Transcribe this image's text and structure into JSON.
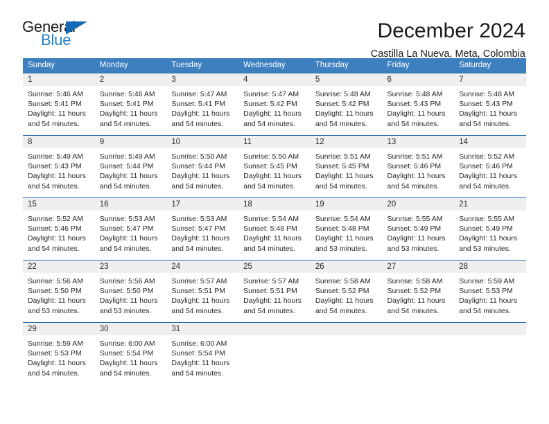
{
  "brand": {
    "name_top": "General",
    "name_bottom": "Blue",
    "triangle_color": "#1469b4",
    "blue_color": "#1f7ec4"
  },
  "header": {
    "title": "December 2024",
    "subtitle": "Castilla La Nueva, Meta, Colombia"
  },
  "theme": {
    "header_bg": "#3d7fbf",
    "row_divider": "#2a6db0",
    "daynum_bg": "#efefef",
    "text": "#272727"
  },
  "weekday_headers": [
    "Sunday",
    "Monday",
    "Tuesday",
    "Wednesday",
    "Thursday",
    "Friday",
    "Saturday"
  ],
  "labels": {
    "sunrise_prefix": "Sunrise:",
    "sunset_prefix": "Sunset:",
    "daylight_prefix": "Daylight:"
  },
  "weeks": [
    [
      {
        "day": "1",
        "sunrise": "Sunrise: 5:46 AM",
        "sunset": "Sunset: 5:41 PM",
        "daylight1": "Daylight: 11 hours",
        "daylight2": "and 54 minutes."
      },
      {
        "day": "2",
        "sunrise": "Sunrise: 5:46 AM",
        "sunset": "Sunset: 5:41 PM",
        "daylight1": "Daylight: 11 hours",
        "daylight2": "and 54 minutes."
      },
      {
        "day": "3",
        "sunrise": "Sunrise: 5:47 AM",
        "sunset": "Sunset: 5:41 PM",
        "daylight1": "Daylight: 11 hours",
        "daylight2": "and 54 minutes."
      },
      {
        "day": "4",
        "sunrise": "Sunrise: 5:47 AM",
        "sunset": "Sunset: 5:42 PM",
        "daylight1": "Daylight: 11 hours",
        "daylight2": "and 54 minutes."
      },
      {
        "day": "5",
        "sunrise": "Sunrise: 5:48 AM",
        "sunset": "Sunset: 5:42 PM",
        "daylight1": "Daylight: 11 hours",
        "daylight2": "and 54 minutes."
      },
      {
        "day": "6",
        "sunrise": "Sunrise: 5:48 AM",
        "sunset": "Sunset: 5:43 PM",
        "daylight1": "Daylight: 11 hours",
        "daylight2": "and 54 minutes."
      },
      {
        "day": "7",
        "sunrise": "Sunrise: 5:48 AM",
        "sunset": "Sunset: 5:43 PM",
        "daylight1": "Daylight: 11 hours",
        "daylight2": "and 54 minutes."
      }
    ],
    [
      {
        "day": "8",
        "sunrise": "Sunrise: 5:49 AM",
        "sunset": "Sunset: 5:43 PM",
        "daylight1": "Daylight: 11 hours",
        "daylight2": "and 54 minutes."
      },
      {
        "day": "9",
        "sunrise": "Sunrise: 5:49 AM",
        "sunset": "Sunset: 5:44 PM",
        "daylight1": "Daylight: 11 hours",
        "daylight2": "and 54 minutes."
      },
      {
        "day": "10",
        "sunrise": "Sunrise: 5:50 AM",
        "sunset": "Sunset: 5:44 PM",
        "daylight1": "Daylight: 11 hours",
        "daylight2": "and 54 minutes."
      },
      {
        "day": "11",
        "sunrise": "Sunrise: 5:50 AM",
        "sunset": "Sunset: 5:45 PM",
        "daylight1": "Daylight: 11 hours",
        "daylight2": "and 54 minutes."
      },
      {
        "day": "12",
        "sunrise": "Sunrise: 5:51 AM",
        "sunset": "Sunset: 5:45 PM",
        "daylight1": "Daylight: 11 hours",
        "daylight2": "and 54 minutes."
      },
      {
        "day": "13",
        "sunrise": "Sunrise: 5:51 AM",
        "sunset": "Sunset: 5:46 PM",
        "daylight1": "Daylight: 11 hours",
        "daylight2": "and 54 minutes."
      },
      {
        "day": "14",
        "sunrise": "Sunrise: 5:52 AM",
        "sunset": "Sunset: 5:46 PM",
        "daylight1": "Daylight: 11 hours",
        "daylight2": "and 54 minutes."
      }
    ],
    [
      {
        "day": "15",
        "sunrise": "Sunrise: 5:52 AM",
        "sunset": "Sunset: 5:46 PM",
        "daylight1": "Daylight: 11 hours",
        "daylight2": "and 54 minutes."
      },
      {
        "day": "16",
        "sunrise": "Sunrise: 5:53 AM",
        "sunset": "Sunset: 5:47 PM",
        "daylight1": "Daylight: 11 hours",
        "daylight2": "and 54 minutes."
      },
      {
        "day": "17",
        "sunrise": "Sunrise: 5:53 AM",
        "sunset": "Sunset: 5:47 PM",
        "daylight1": "Daylight: 11 hours",
        "daylight2": "and 54 minutes."
      },
      {
        "day": "18",
        "sunrise": "Sunrise: 5:54 AM",
        "sunset": "Sunset: 5:48 PM",
        "daylight1": "Daylight: 11 hours",
        "daylight2": "and 54 minutes."
      },
      {
        "day": "19",
        "sunrise": "Sunrise: 5:54 AM",
        "sunset": "Sunset: 5:48 PM",
        "daylight1": "Daylight: 11 hours",
        "daylight2": "and 53 minutes."
      },
      {
        "day": "20",
        "sunrise": "Sunrise: 5:55 AM",
        "sunset": "Sunset: 5:49 PM",
        "daylight1": "Daylight: 11 hours",
        "daylight2": "and 53 minutes."
      },
      {
        "day": "21",
        "sunrise": "Sunrise: 5:55 AM",
        "sunset": "Sunset: 5:49 PM",
        "daylight1": "Daylight: 11 hours",
        "daylight2": "and 53 minutes."
      }
    ],
    [
      {
        "day": "22",
        "sunrise": "Sunrise: 5:56 AM",
        "sunset": "Sunset: 5:50 PM",
        "daylight1": "Daylight: 11 hours",
        "daylight2": "and 53 minutes."
      },
      {
        "day": "23",
        "sunrise": "Sunrise: 5:56 AM",
        "sunset": "Sunset: 5:50 PM",
        "daylight1": "Daylight: 11 hours",
        "daylight2": "and 53 minutes."
      },
      {
        "day": "24",
        "sunrise": "Sunrise: 5:57 AM",
        "sunset": "Sunset: 5:51 PM",
        "daylight1": "Daylight: 11 hours",
        "daylight2": "and 54 minutes."
      },
      {
        "day": "25",
        "sunrise": "Sunrise: 5:57 AM",
        "sunset": "Sunset: 5:51 PM",
        "daylight1": "Daylight: 11 hours",
        "daylight2": "and 54 minutes."
      },
      {
        "day": "26",
        "sunrise": "Sunrise: 5:58 AM",
        "sunset": "Sunset: 5:52 PM",
        "daylight1": "Daylight: 11 hours",
        "daylight2": "and 54 minutes."
      },
      {
        "day": "27",
        "sunrise": "Sunrise: 5:58 AM",
        "sunset": "Sunset: 5:52 PM",
        "daylight1": "Daylight: 11 hours",
        "daylight2": "and 54 minutes."
      },
      {
        "day": "28",
        "sunrise": "Sunrise: 5:59 AM",
        "sunset": "Sunset: 5:53 PM",
        "daylight1": "Daylight: 11 hours",
        "daylight2": "and 54 minutes."
      }
    ],
    [
      {
        "day": "29",
        "sunrise": "Sunrise: 5:59 AM",
        "sunset": "Sunset: 5:53 PM",
        "daylight1": "Daylight: 11 hours",
        "daylight2": "and 54 minutes."
      },
      {
        "day": "30",
        "sunrise": "Sunrise: 6:00 AM",
        "sunset": "Sunset: 5:54 PM",
        "daylight1": "Daylight: 11 hours",
        "daylight2": "and 54 minutes."
      },
      {
        "day": "31",
        "sunrise": "Sunrise: 6:00 AM",
        "sunset": "Sunset: 5:54 PM",
        "daylight1": "Daylight: 11 hours",
        "daylight2": "and 54 minutes."
      },
      {
        "day": "",
        "sunrise": "",
        "sunset": "",
        "daylight1": "",
        "daylight2": ""
      },
      {
        "day": "",
        "sunrise": "",
        "sunset": "",
        "daylight1": "",
        "daylight2": ""
      },
      {
        "day": "",
        "sunrise": "",
        "sunset": "",
        "daylight1": "",
        "daylight2": ""
      },
      {
        "day": "",
        "sunrise": "",
        "sunset": "",
        "daylight1": "",
        "daylight2": ""
      }
    ]
  ]
}
